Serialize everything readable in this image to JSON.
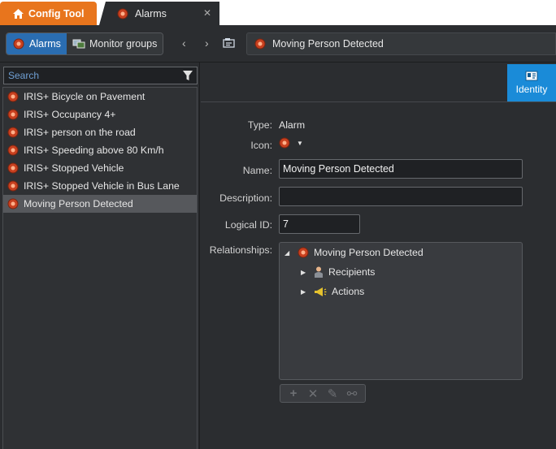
{
  "tabs": {
    "config_tool": "Config Tool",
    "alarms": "Alarms"
  },
  "toolbar": {
    "seg_alarms": "Alarms",
    "seg_monitor_groups": "Monitor groups",
    "path_title": "Moving Person Detected"
  },
  "search": {
    "placeholder": "Search"
  },
  "alarm_list": [
    "IRIS+ Bicycle on Pavement",
    "IRIS+ Occupancy 4+",
    "IRIS+ person on the road",
    "IRIS+ Speeding above 80 Km/h",
    "IRIS+ Stopped Vehicle",
    "IRIS+ Stopped Vehicle in Bus Lane",
    "Moving Person Detected"
  ],
  "identity_tab": "Identity",
  "form": {
    "type_label": "Type:",
    "type_value": "Alarm",
    "icon_label": "Icon:",
    "name_label": "Name:",
    "name_value": "Moving Person Detected",
    "description_label": "Description:",
    "description_value": "",
    "logical_id_label": "Logical ID:",
    "logical_id_value": "7",
    "relationships_label": "Relationships:"
  },
  "tree": {
    "root": "Moving Person Detected",
    "child1": "Recipients",
    "child2": "Actions"
  },
  "colors": {
    "accent_blue": "#2a6db1",
    "identity_blue": "#1a8bd8",
    "config_orange": "#e8751d",
    "alarm_red": "#c8401f"
  }
}
